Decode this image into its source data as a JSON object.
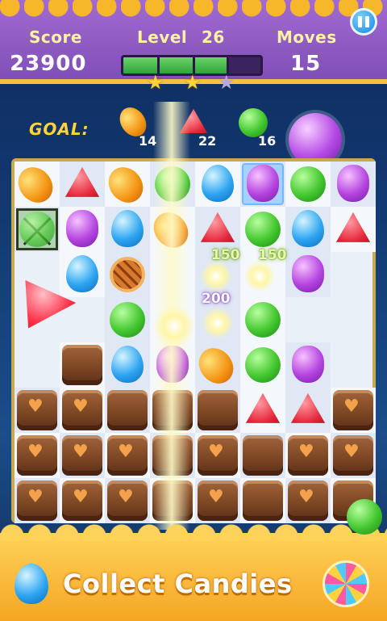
{
  "header": {
    "score_label": "Score",
    "score_value": "23900",
    "level_label": "Level",
    "level_value": "26",
    "moves_label": "Moves",
    "moves_value": "15",
    "progress_fraction": 0.75,
    "stars": [
      true,
      true,
      false
    ]
  },
  "goal": {
    "label": "GOAL:",
    "items": [
      {
        "candy": "orange-jelly",
        "count": "14"
      },
      {
        "candy": "red-drop",
        "count": "22"
      },
      {
        "candy": "green-ball",
        "count": "16"
      }
    ]
  },
  "board": {
    "points_popups": [
      "150",
      "150",
      "200"
    ]
  },
  "footer": {
    "title": "Collect Candies"
  }
}
